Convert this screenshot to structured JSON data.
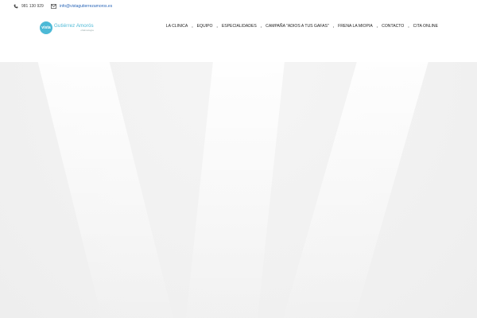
{
  "topbar": {
    "phone": {
      "icon": "phone-icon",
      "text": "981 130 929"
    },
    "email": {
      "icon": "envelope-icon",
      "text": "info@vistagutierrezamoros.es"
    }
  },
  "logo": {
    "mark": "vista",
    "name": "Gutiérrez Amorós",
    "sub": "oftalmología",
    "color": "#4cb9d6"
  },
  "nav": {
    "items": [
      {
        "label": "LA CLINICA"
      },
      {
        "label": "EQUIPO"
      },
      {
        "label": "ESPECIALIDADES"
      },
      {
        "label": "CAMPAÑA \"ADIOS A TUS GAFAS\""
      },
      {
        "label": "FRENA LA MIOPIA"
      },
      {
        "label": "CONTACTO"
      },
      {
        "label": "CITA ONLINE"
      }
    ],
    "separator": "•"
  },
  "hero": {
    "background": "#f1f1f1"
  }
}
